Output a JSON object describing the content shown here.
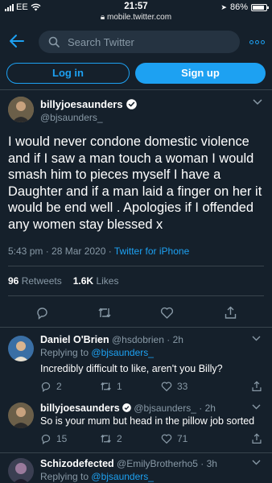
{
  "status_bar": {
    "carrier": "EE",
    "time": "21:57",
    "url": "mobile.twitter.com",
    "battery": "86%",
    "battery_level": 0.86
  },
  "nav": {
    "search_placeholder": "Search Twitter"
  },
  "auth": {
    "login_label": "Log in",
    "signup_label": "Sign up"
  },
  "tweet": {
    "author_name": "billyjoesaunders",
    "handle": "@bjsaunders_",
    "text": "I would never condone domestic violence and if I saw a man touch a woman I would smash him to  pieces myself I have a Daughter and if a man laid a finger on her it would be end well . Apologies if I offended any women stay blessed x",
    "timestamp": "5:43 pm · 28 Mar 2020",
    "source": "Twitter for iPhone",
    "retweets_count": "96",
    "retweets_label": "Retweets",
    "likes_count": "1.6K",
    "likes_label": "Likes"
  },
  "replies": [
    {
      "name": "Daniel O'Brien",
      "handle": "@hsdobrien",
      "time": "2h",
      "replying_prefix": "Replying to",
      "replying_to": "@bjsaunders_",
      "text": "Incredibly difficult to like, aren't you Billy?",
      "reply_count": "2",
      "retweet_count": "1",
      "like_count": "33"
    },
    {
      "name": "billyjoesaunders",
      "handle": "@bjsaunders_",
      "time": "2h",
      "text": "So is your mum but head in the pillow job sorted",
      "reply_count": "15",
      "retweet_count": "2",
      "like_count": "71"
    },
    {
      "name": "Schizodefected",
      "handle": "@EmilyBrotherho5",
      "time": "3h",
      "replying_prefix": "Replying to",
      "replying_to": "@bjsaunders_"
    }
  ],
  "colors": {
    "background": "#15202b",
    "accent": "#1da1f2",
    "secondary_text": "#8899a6",
    "divider": "#38444d"
  }
}
